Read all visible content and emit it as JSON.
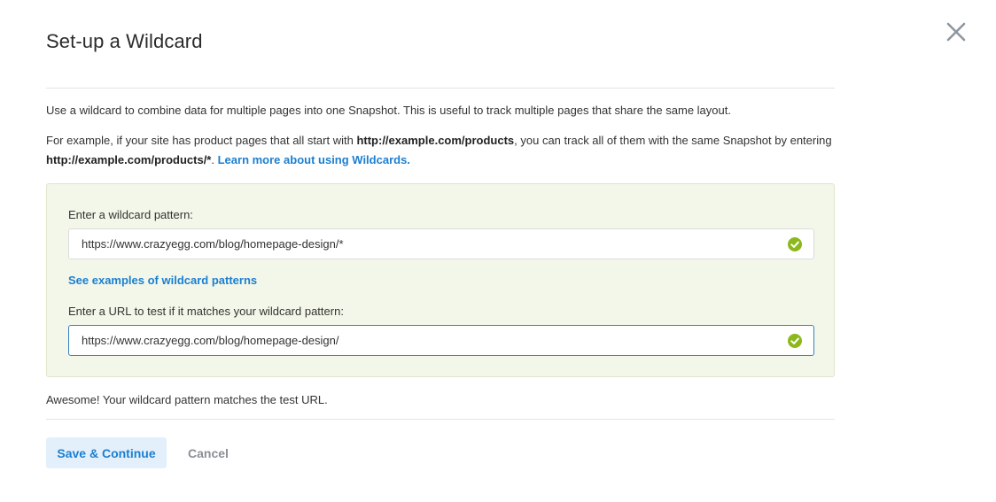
{
  "dialog": {
    "title": "Set-up a Wildcard",
    "close_icon": "close-icon"
  },
  "intro": {
    "text": "Use a wildcard to combine data for multiple pages into one Snapshot. This is useful to track multiple pages that share the same layout."
  },
  "example": {
    "prefix": "For example, if your site has product pages that all start with ",
    "url_bold": "http://example.com/products",
    "middle": ", you can track all of them with the same Snapshot by entering ",
    "pattern_bold": "http://example.com/products/*",
    "after_pattern": ". ",
    "learn_more_link": "Learn more about using Wildcards."
  },
  "panel": {
    "pattern_label": "Enter a wildcard pattern:",
    "pattern_value": "https://www.crazyegg.com/blog/homepage-design/*",
    "examples_link": "See examples of wildcard patterns",
    "test_label": "Enter a URL to test if it matches your wildcard pattern:",
    "test_value": "https://www.crazyegg.com/blog/homepage-design/",
    "check_icon": "check-circle-icon",
    "accent_color": "#8cb81c"
  },
  "status": {
    "message": "Awesome! Your wildcard pattern matches the test URL."
  },
  "actions": {
    "save_label": "Save & Continue",
    "cancel_label": "Cancel"
  },
  "colors": {
    "link": "#1b7fd1",
    "panel_bg": "#f3f7e9",
    "save_bg": "#e3f0fb"
  }
}
